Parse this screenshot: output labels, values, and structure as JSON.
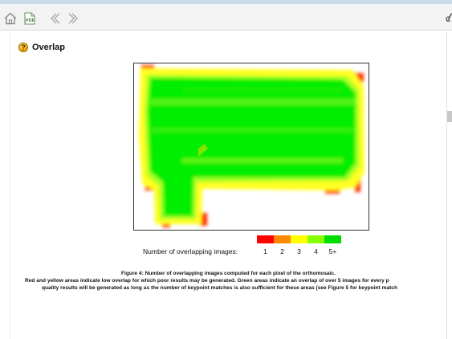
{
  "toolbar": {
    "home_icon": "home-icon",
    "pdf_icon": "pdf-icon",
    "back_icon": "back-icon",
    "forward_icon": "forward-icon",
    "right_text": "c"
  },
  "section": {
    "icon": "help-icon",
    "icon_glyph": "?",
    "title": "Overlap"
  },
  "legend": {
    "label": "Number of overlapping images:",
    "items": [
      {
        "color": "#ff0000",
        "label": "1"
      },
      {
        "color": "#ff8800",
        "label": "2"
      },
      {
        "color": "#ffff00",
        "label": "3"
      },
      {
        "color": "#88ff00",
        "label": "4"
      },
      {
        "color": "#00dd00",
        "label": "5+"
      }
    ]
  },
  "caption": {
    "title": "Figure 4: Number of overlapping images computed for each pixel of the orthomosaic.",
    "line1": "Red and yellow areas indicate low overlap for which poor results may be generated. Green areas indicate an overlap of over 5 images for every p",
    "line2": "quality results will be generated as long as the number of keypoint matches is also sufficient for these areas (see Figure 5 for keypoint match"
  },
  "colors": {
    "toolbar_bg": "#f3f3f3",
    "toolbar_icon": "#9a9a9a",
    "accent_green": "#00dd00"
  }
}
